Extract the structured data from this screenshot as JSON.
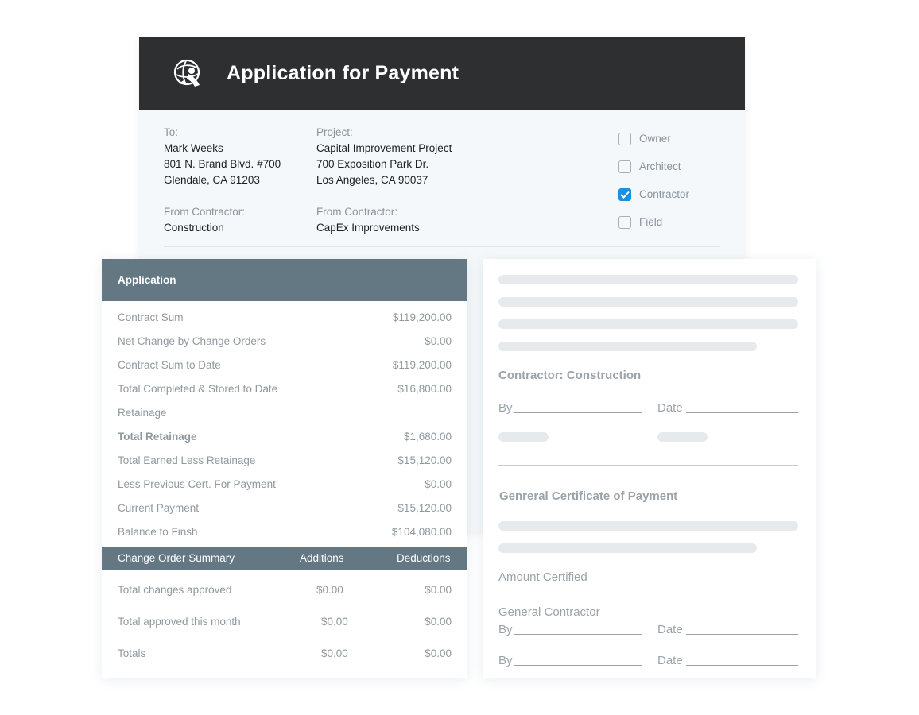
{
  "header": {
    "title": "Application for Payment",
    "logo_icon": "globe-atlas-logo-icon"
  },
  "address": {
    "to": {
      "label": "To:",
      "name": "Mark Weeks",
      "line1": "801 N. Brand Blvd. #700",
      "line2": "Glendale, CA 91203"
    },
    "project": {
      "label": "Project:",
      "name": "Capital Improvement Project",
      "line1": "700 Exposition Park Dr.",
      "line2": "Los Angeles, CA 90037"
    },
    "from_left": {
      "label": "From Contractor:",
      "value": "Construction"
    },
    "from_right": {
      "label": "From Contractor:",
      "value": "CapEx Improvements"
    }
  },
  "recipients": [
    {
      "label": "Owner",
      "checked": false
    },
    {
      "label": "Architect",
      "checked": false
    },
    {
      "label": "Contractor",
      "checked": true
    },
    {
      "label": "Field",
      "checked": false
    }
  ],
  "application": {
    "title": "Application",
    "rows": [
      {
        "label": "Contract Sum",
        "value": "$119,200.00"
      },
      {
        "label": "Net Change by Change Orders",
        "value": "$0.00"
      },
      {
        "label": "Contract Sum to Date",
        "value": "$119,200.00"
      },
      {
        "label": "Total Completed & Stored to Date",
        "value": "$16,800.00"
      },
      {
        "label": "Retainage",
        "value": ""
      },
      {
        "label": "Total Retainage",
        "value": "$1,680.00"
      },
      {
        "label": "Total Earned Less Retainage",
        "value": "$15,120.00"
      },
      {
        "label": "Less Previous Cert. For Payment",
        "value": "$0.00"
      },
      {
        "label": "Current Payment",
        "value": "$15,120.00"
      },
      {
        "label": "Balance to Finsh",
        "value": "$104,080.00"
      }
    ]
  },
  "change_orders": {
    "headers": {
      "summary": "Change Order Summary",
      "additions": "Additions",
      "deductions": "Deductions"
    },
    "rows": [
      {
        "label": "Total changes approved",
        "additions": "$0.00",
        "deductions": "$0.00"
      },
      {
        "label": "Total approved this month",
        "additions": "$0.00",
        "deductions": "$0.00"
      },
      {
        "label": "Totals",
        "additions": "$0.00",
        "deductions": "$0.00"
      }
    ]
  },
  "signature": {
    "contractor_heading": "Contractor: Construction",
    "by_label": "By",
    "date_label": "Date",
    "certificate_heading": "Genreral Certificate of Payment",
    "amount_certified_label": "Amount Certified",
    "general_contractor_label": "General Contractor"
  },
  "colors": {
    "header_bg": "#2e2f31",
    "table_header_bg": "#647884",
    "checkbox_accent": "#1d8fe0"
  }
}
